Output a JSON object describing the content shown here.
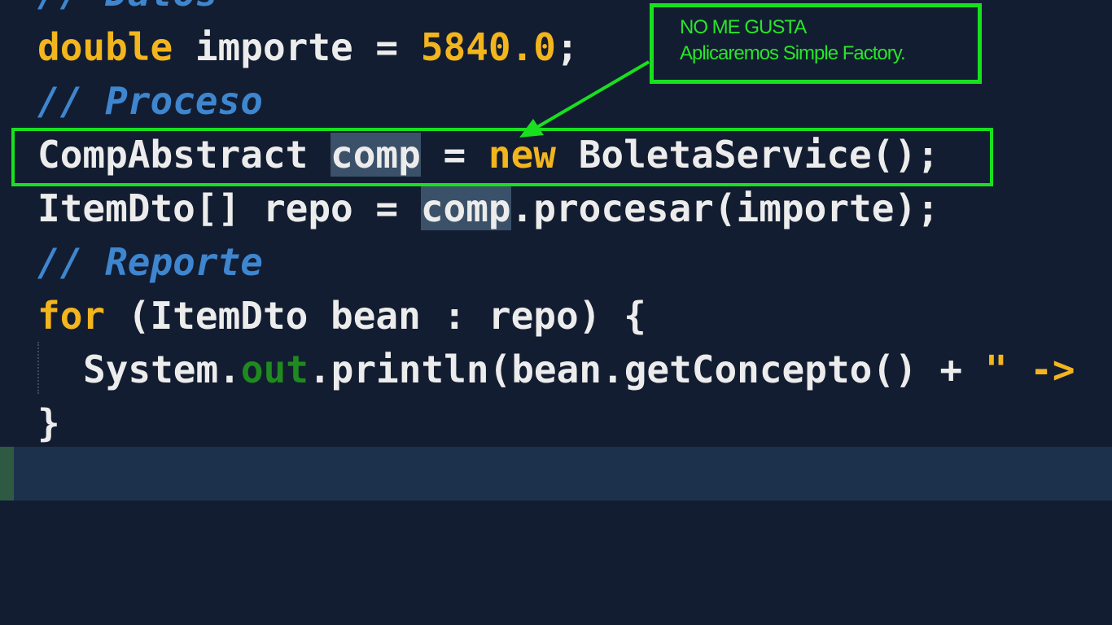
{
  "code": {
    "line0_comment": "// Datos",
    "line1": {
      "type": "double",
      "rest1": " importe = ",
      "number": "5840.0",
      "end": ";"
    },
    "line2_comment": "// Proceso",
    "line3": {
      "cls": "CompAbstract ",
      "var": "comp",
      "mid": " = ",
      "kw_new": "new",
      "rest": " BoletaService();"
    },
    "line4": {
      "start": "ItemDto[] repo = ",
      "var": "comp",
      "rest": ".procesar(importe);"
    },
    "line5_comment": "// Reporte",
    "line6": {
      "kw_for": "for",
      "rest": " (ItemDto bean : repo) {"
    },
    "line7": {
      "start": "System.",
      "field": "out",
      "mid": ".println(bean.getConcepto() + ",
      "string": "\" ->"
    },
    "line8": "}",
    "line9": "}"
  },
  "annotation": {
    "line1": "NO ME GUSTA",
    "line2": "Aplicaremos Simple Factory."
  },
  "colors": {
    "background": "#131d31",
    "keyword": "#f2b51d",
    "comment": "#3e86cf",
    "highlight_annotation": "#19e01f",
    "word_highlight": "#3b5169",
    "current_line": "#1c314c"
  }
}
